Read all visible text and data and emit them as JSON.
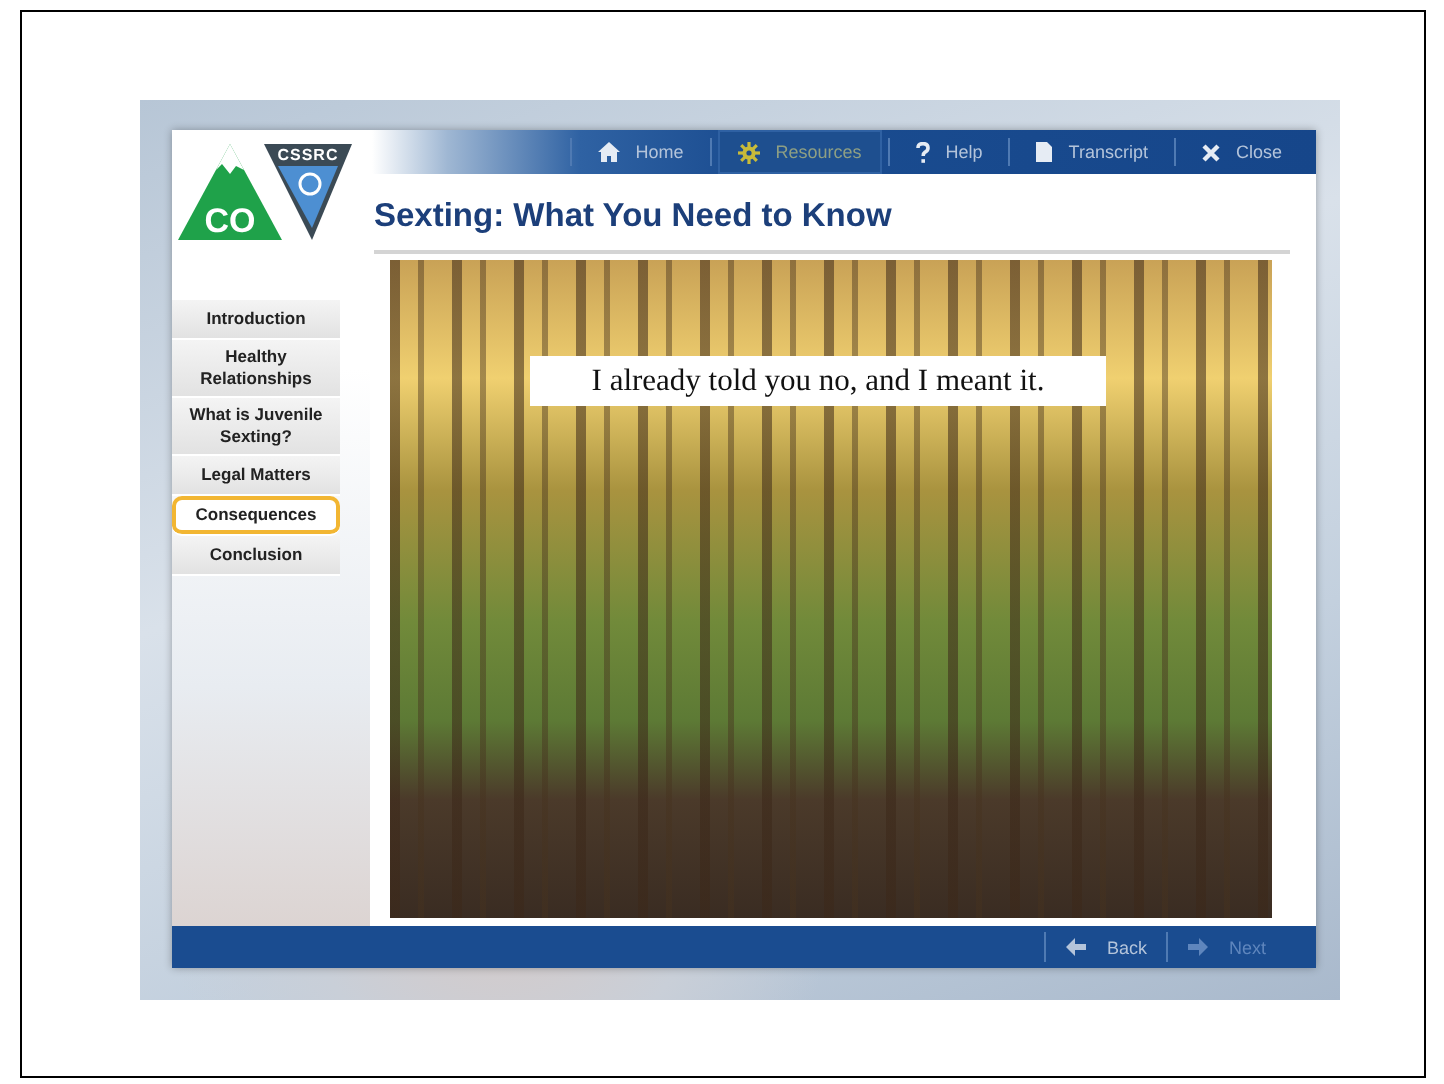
{
  "logo": {
    "left_text": "CO",
    "right_text": "CSSRC"
  },
  "toolbar": [
    {
      "kind": "home",
      "label": "Home",
      "selected": false
    },
    {
      "kind": "resources",
      "label": "Resources",
      "selected": true
    },
    {
      "kind": "help",
      "label": "Help",
      "selected": false
    },
    {
      "kind": "transcript",
      "label": "Transcript",
      "selected": false
    },
    {
      "kind": "close",
      "label": "Close",
      "selected": false
    }
  ],
  "title": "Sexting: What You Need to Know",
  "menu": [
    {
      "label": "Introduction",
      "selected": false
    },
    {
      "label": "Healthy Relationships",
      "selected": false
    },
    {
      "label": "What is Juvenile Sexting?",
      "selected": false
    },
    {
      "label": "Legal Matters",
      "selected": false
    },
    {
      "label": "Consequences",
      "selected": true
    },
    {
      "label": "Conclusion",
      "selected": false
    }
  ],
  "slide": {
    "caption": "I already told you no, and I meant it."
  },
  "footer": [
    {
      "kind": "back",
      "label": "Back",
      "disabled": false
    },
    {
      "kind": "next",
      "label": "Next",
      "disabled": true
    }
  ]
}
